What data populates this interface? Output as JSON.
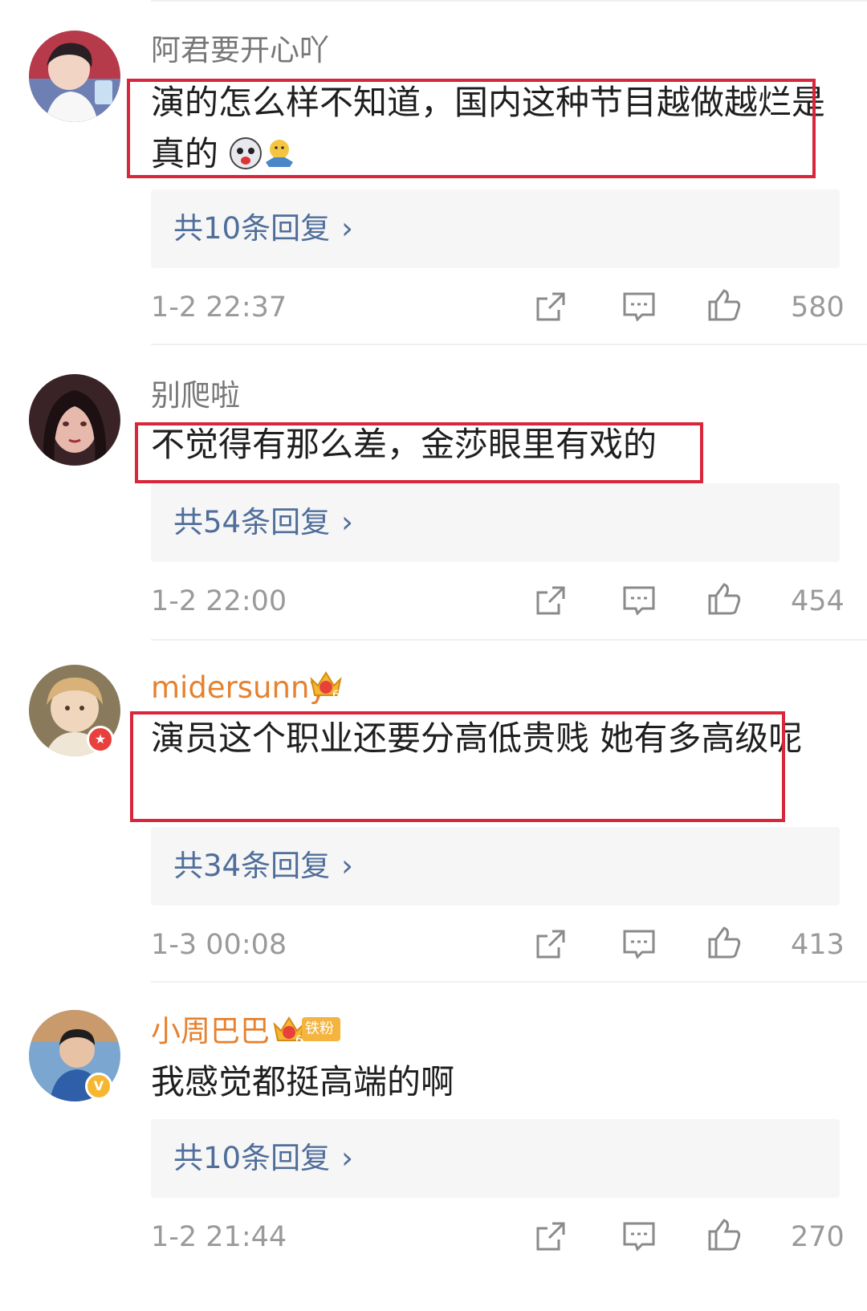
{
  "comments": [
    {
      "username": "阿君要开心吖",
      "content": "演的怎么样不知道，国内这种节目越做越烂是真的",
      "reply_text": "共10条回复",
      "time": "1-2 22:37",
      "likes": "580"
    },
    {
      "username": "别爬啦",
      "content": "不觉得有那么差，金莎眼里有戏的",
      "reply_text": "共54条回复",
      "time": "1-2 22:00",
      "likes": "454"
    },
    {
      "username": "midersunny",
      "badge_level": "6",
      "content": "演员这个职业还要分高低贵贱 她有多高级呢",
      "reply_text": "共34条回复",
      "time": "1-3 00:08",
      "likes": "413"
    },
    {
      "username": "小周巴巴",
      "badge_level": "6",
      "fan_badge": "铁粉",
      "content": "我感觉都挺高端的啊",
      "reply_text": "共10条回复",
      "time": "1-2 21:44",
      "likes": "270"
    }
  ],
  "icons": {
    "share": "share-icon",
    "comment": "comment-icon",
    "like": "thumbs-up-icon",
    "chevron": "chevron-right-icon",
    "crown": "crown-badge-icon"
  },
  "colors": {
    "highlight": "#d8263a",
    "reply_link": "#4f6e9b",
    "vip_name": "#e5812f",
    "meta": "#9a9a9a"
  }
}
